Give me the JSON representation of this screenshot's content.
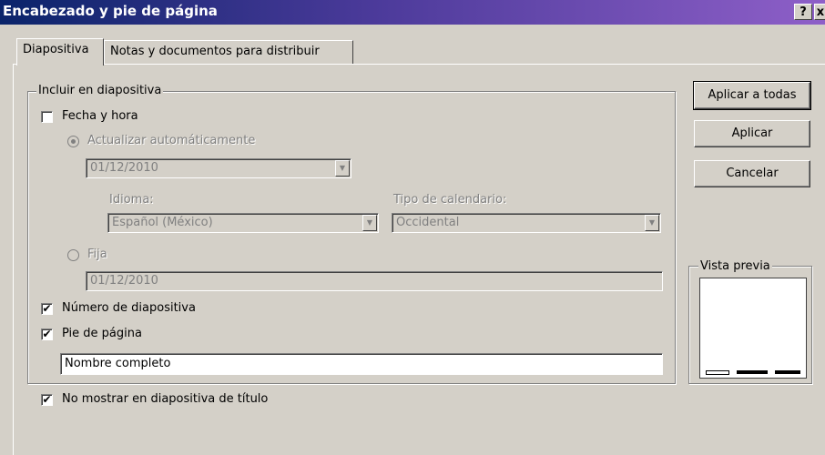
{
  "window": {
    "title": "Encabezado y pie de página",
    "help_label": "?",
    "close_label": "x"
  },
  "tabs": [
    {
      "label": "Diapositiva",
      "active": true
    },
    {
      "label": "Notas y documentos para distribuir",
      "active": false
    }
  ],
  "include_group": {
    "label": "Incluir en diapositiva",
    "date_time": {
      "label": "Fecha y hora",
      "checked": false
    },
    "auto_update": {
      "label": "Actualizar automáticamente",
      "selected": true,
      "date_value": "01/12/2010"
    },
    "language": {
      "label": "Idioma:",
      "value": "Español (México)"
    },
    "calendar": {
      "label": "Tipo de calendario:",
      "value": "Occidental"
    },
    "fixed": {
      "label": "Fija",
      "selected": false,
      "value": "01/12/2010"
    },
    "slide_number": {
      "label": "Número de diapositiva",
      "checked": true
    },
    "footer": {
      "label": "Pie de página",
      "checked": true,
      "value": "Nombre completo"
    }
  },
  "no_title": {
    "label": "No mostrar en diapositiva de título",
    "checked": true
  },
  "buttons": {
    "apply_all": "Aplicar a todas",
    "apply": "Aplicar",
    "cancel": "Cancelar"
  },
  "preview": {
    "label": "Vista previa"
  },
  "check_mark": "✔",
  "dropdown_arrow": "▼"
}
